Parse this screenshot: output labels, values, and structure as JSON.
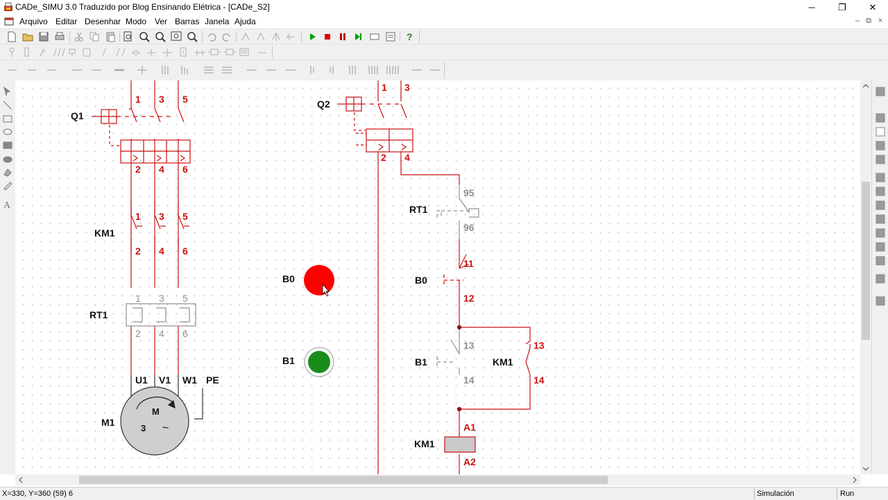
{
  "window": {
    "title": "CADe_SIMU 3.0 Traduzido por Blog Ensinando Elétrica - [CADe_S2]",
    "minimize": "─",
    "maximize": "❐",
    "close": "✕"
  },
  "menu": {
    "items": [
      "Arquivo",
      "Editar",
      "Desenhar",
      "Modo",
      "Ver",
      "Barras",
      "Janela",
      "Ajuda"
    ],
    "mdi_controls": [
      "–",
      "⧉",
      "×"
    ]
  },
  "simulation_controls": {
    "play_color": "#00a000",
    "stop_color": "#e00000",
    "pause_color": "#c00000",
    "step_color": "#00a000"
  },
  "status": {
    "coords": "X=330, Y=360 (59) 6",
    "mode": "Simulación",
    "state": "Run"
  },
  "colors": {
    "active_wire": "#cc1111",
    "inactive_wire": "#808080",
    "stop_button": "#ff0000",
    "start_button": "#1a8c1a"
  },
  "diagram": {
    "power_circuit": {
      "q1": {
        "label": "Q1",
        "top_terminals": [
          "1",
          "3",
          "5"
        ],
        "bottom_terminals": [
          "2",
          "4",
          "6"
        ]
      },
      "km1": {
        "label": "KM1",
        "top_terminals": [
          "1",
          "3",
          "5"
        ],
        "bottom_terminals": [
          "2",
          "4",
          "6"
        ]
      },
      "rt1": {
        "label": "RT1",
        "top_terminals": [
          "1",
          "3",
          "5"
        ],
        "bottom_terminals": [
          "2",
          "4",
          "6"
        ]
      },
      "motor": {
        "label": "M1",
        "terminals": [
          "U1",
          "V1",
          "W1",
          "PE"
        ],
        "symbol": "M",
        "phases": "3",
        "ac": "~"
      }
    },
    "pushbuttons": {
      "b0": {
        "label": "B0"
      },
      "b1": {
        "label": "B1"
      }
    },
    "control_circuit": {
      "q2": {
        "label": "Q2",
        "top_terminals": [
          "1",
          "3"
        ],
        "bottom_terminals": [
          "2",
          "4"
        ]
      },
      "rt1_contact": {
        "label": "RT1",
        "terminals": [
          "95",
          "96"
        ]
      },
      "b0_contact": {
        "label": "B0",
        "terminals": [
          "11",
          "12"
        ]
      },
      "b1_contact": {
        "label": "B1",
        "terminals": [
          "13",
          "14"
        ]
      },
      "km1_contact": {
        "label": "KM1",
        "terminals": [
          "13",
          "14"
        ]
      },
      "km1_coil": {
        "label": "KM1",
        "terminals": [
          "A1",
          "A2"
        ]
      }
    }
  }
}
